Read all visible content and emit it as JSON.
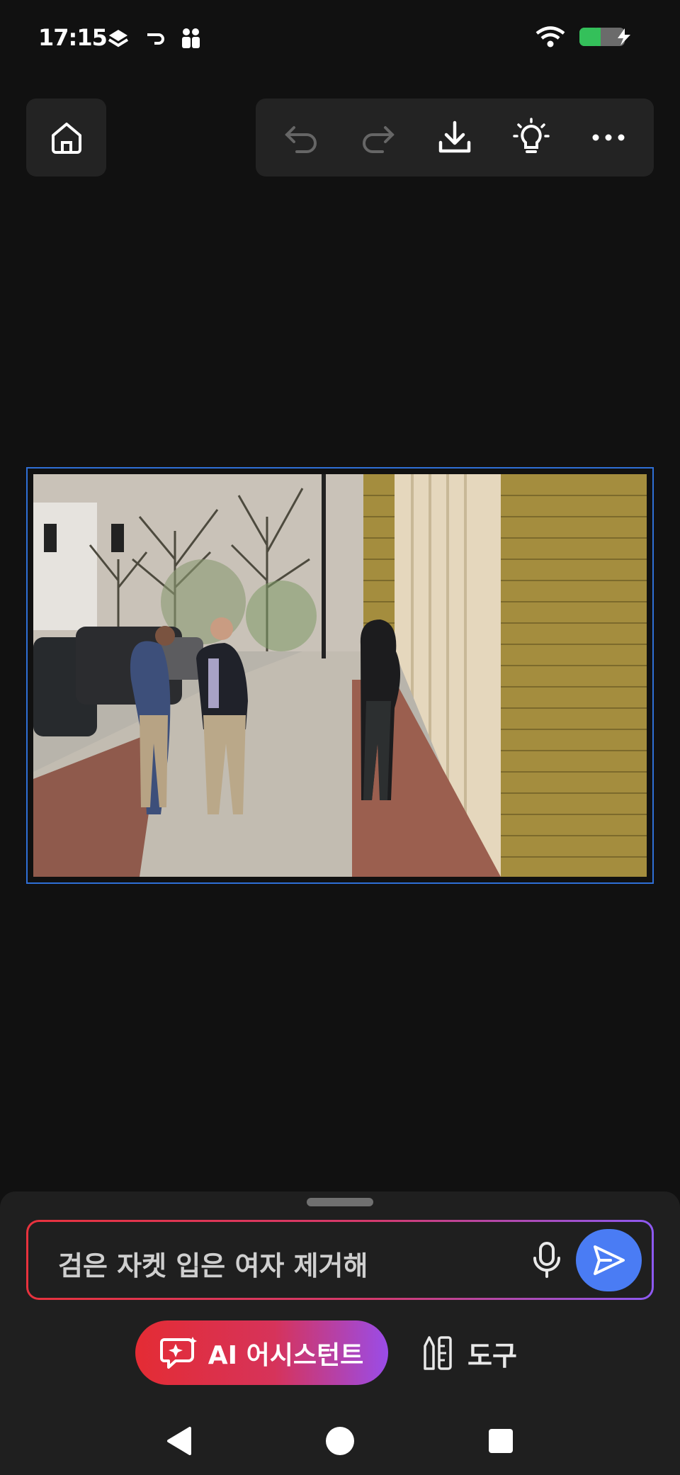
{
  "status": {
    "time": "17:15"
  },
  "toolbar": {
    "home_icon": "home-icon",
    "undo_icon": "undo-icon",
    "redo_icon": "redo-icon",
    "download_icon": "download-icon",
    "tips_icon": "lightbulb-icon",
    "more_icon": "more-icon"
  },
  "colors": {
    "background": "#111111",
    "panel": "#232323",
    "selection": "#2f6fd6",
    "send": "#4a7cf4",
    "ai_gradient_start": "#e42c34",
    "ai_gradient_end": "#9a4ce8"
  },
  "prompt": {
    "text": "검은 자켓 입은 여자 제거해"
  },
  "actions": {
    "ai_assistant_label": "AI 어시스턴트",
    "tools_label": "도구"
  }
}
